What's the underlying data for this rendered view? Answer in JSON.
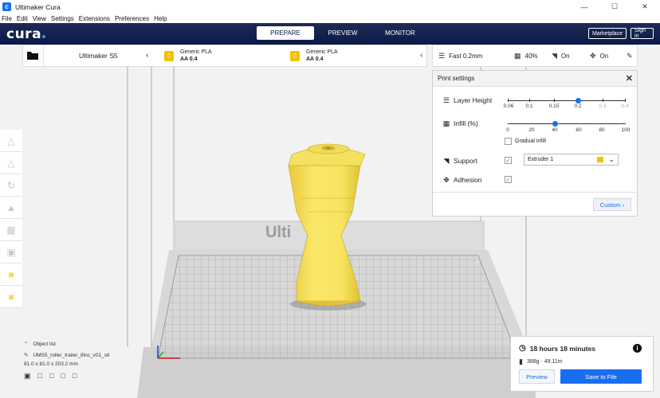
{
  "window": {
    "title": "Ultimaker Cura",
    "app_icon": "cura-app-icon"
  },
  "menu": [
    "File",
    "Edit",
    "View",
    "Settings",
    "Extensions",
    "Preferences",
    "Help"
  ],
  "header": {
    "logo": "cura",
    "tabs": [
      {
        "label": "PREPARE",
        "active": true
      },
      {
        "label": "PREVIEW",
        "active": false
      },
      {
        "label": "MONITOR",
        "active": false
      }
    ],
    "marketplace": "Marketplace",
    "signin": "Sign in"
  },
  "printer": {
    "name": "Ultimaker S5",
    "extruders": [
      {
        "number": "1",
        "material": "Generic PLA",
        "core": "AA 0.4",
        "color": "#f3c200"
      },
      {
        "number": "2",
        "material": "Generic PLA",
        "core": "AA 0.4",
        "color": "#f3c200"
      }
    ]
  },
  "print_bar": {
    "profile": "Fast 0.2mm",
    "infill": "40%",
    "support": "On",
    "adhesion": "On"
  },
  "print_settings": {
    "title": "Print settings",
    "layer_height": {
      "label": "Layer Height",
      "ticks": [
        "0.06",
        "0.1",
        "0.15",
        "0.2",
        "0.3",
        "0.4"
      ],
      "selected": "0.2"
    },
    "infill": {
      "label": "Infill (%)",
      "ticks": [
        "0",
        "20",
        "40",
        "60",
        "80",
        "100"
      ],
      "value": 40,
      "gradual_label": "Gradual infill",
      "gradual_checked": false
    },
    "support": {
      "label": "Support",
      "checked": true,
      "extruder": "Extruder 1"
    },
    "adhesion": {
      "label": "Adhesion",
      "checked": true
    },
    "custom_button": "Custom"
  },
  "object_list": {
    "toggle_label": "Object list",
    "filename": "UMS5_roller_trailer_8inc_v01_stl",
    "dimensions": "81.0 x 81.0 x 203.2 mm"
  },
  "build_plate_text": "Ulti",
  "print_job": {
    "time": "18 hours 18 minutes",
    "material": "388g · 49.11m",
    "preview_button": "Preview",
    "save_button": "Save to File"
  },
  "colors": {
    "accent": "#196ef0",
    "header": "#0a1a48",
    "model": "#f7e35f",
    "material": "#f3c200"
  }
}
